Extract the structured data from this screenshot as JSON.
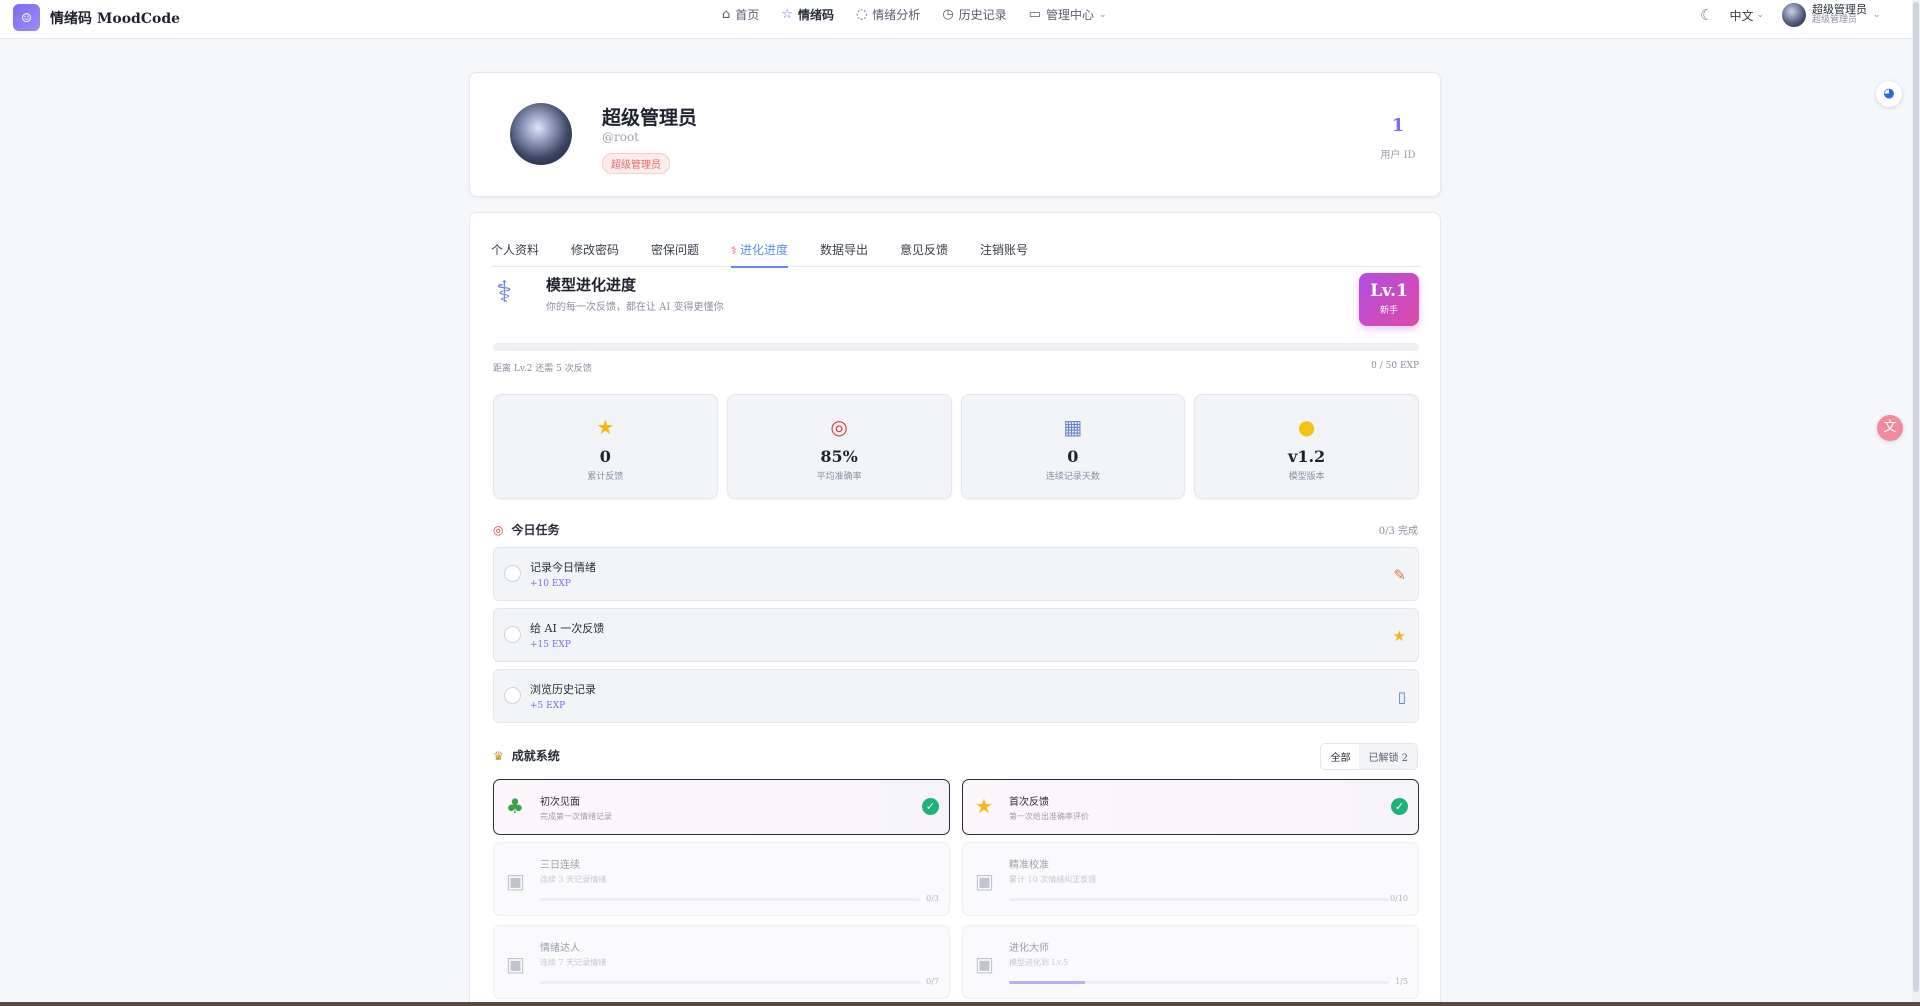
{
  "brand": {
    "logo_glyph": "☺",
    "name": "情绪码 MoodCode"
  },
  "nav": [
    {
      "icon": "home-icon",
      "glyph": "⌂",
      "label": "首页",
      "active": false
    },
    {
      "icon": "star-icon",
      "glyph": "☆",
      "label": "情绪码",
      "active": true
    },
    {
      "icon": "chat-icon",
      "glyph": "◌",
      "label": "情绪分析",
      "active": false
    },
    {
      "icon": "clock-icon",
      "glyph": "◷",
      "label": "历史记录",
      "active": false
    },
    {
      "icon": "admin-icon",
      "glyph": "▭",
      "label": "管理中心",
      "active": false
    }
  ],
  "topright": {
    "lang": "中文",
    "user_name": "超级管理员",
    "user_role": "超级管理员"
  },
  "profile": {
    "name": "超级管理员",
    "handle": "@root",
    "badge": "超级管理员",
    "id_value": "1",
    "id_label": "用户 ID"
  },
  "tabs": [
    "个人资料",
    "修改密码",
    "密保问题",
    "进化进度",
    "数据导出",
    "意见反馈",
    "注销账号"
  ],
  "evolution": {
    "title": "模型进化进度",
    "subtitle": "你的每一次反馈，都在让 AI 变得更懂你",
    "level": "Lv.1",
    "level_name": "新手",
    "progress_left": "距离 Lv.2 还需 5 次反馈",
    "progress_right": "0 / 50 EXP",
    "progress_fraction": 0.0
  },
  "stats": [
    {
      "icon": "star-icon",
      "glyph": "★",
      "color": "#f5b81c",
      "value": "0",
      "label": "累计反馈"
    },
    {
      "icon": "target-icon",
      "glyph": "◎",
      "color": "#e03b3b",
      "value": "85%",
      "label": "平均准确率"
    },
    {
      "icon": "chart-icon",
      "glyph": "▦",
      "color": "#6b86c8",
      "value": "0",
      "label": "连续记录天数"
    },
    {
      "icon": "bulb-icon",
      "glyph": "●",
      "color": "#f5c21c",
      "value": "v1.2",
      "label": "模型版本"
    }
  ],
  "tasks": {
    "title": "今日任务",
    "status": "0/3 完成",
    "items": [
      {
        "name": "记录今日情绪",
        "exp": "+10 EXP",
        "icon": "memo-icon",
        "glyph": "✎",
        "color": "#e07a3b"
      },
      {
        "name": "给 AI 一次反馈",
        "exp": "+15 EXP",
        "icon": "star-icon",
        "glyph": "★",
        "color": "#f5b81c"
      },
      {
        "name": "浏览历史记录",
        "exp": "+5 EXP",
        "icon": "book-icon",
        "glyph": "▯",
        "color": "#4a7fd0"
      }
    ]
  },
  "achievements": {
    "title": "成就系统",
    "filter_all": "全部",
    "filter_unlocked": "已解锁 2",
    "items": [
      {
        "name": "初次见面",
        "desc": "完成第一次情绪记录",
        "icon": "sprout-icon",
        "glyph": "♣",
        "color": "#3aa04a",
        "done": true
      },
      {
        "name": "首次反馈",
        "desc": "第一次给出准确率评价",
        "icon": "star-icon",
        "glyph": "★",
        "color": "#f5b81c",
        "done": true
      },
      {
        "name": "三日连续",
        "desc": "连续 3 天记录情绪",
        "icon": "lock-icon",
        "glyph": "▣",
        "done": false,
        "progress": 0,
        "count": "0/3"
      },
      {
        "name": "精准校准",
        "desc": "累计 10 次情绪纠正反馈",
        "icon": "lock-icon",
        "glyph": "▣",
        "done": false,
        "progress": 0,
        "count": "0/10"
      },
      {
        "name": "情绪达人",
        "desc": "连续 7 天记录情绪",
        "icon": "lock-icon",
        "glyph": "▣",
        "done": false,
        "progress": 0,
        "count": "0/7"
      },
      {
        "name": "进化大师",
        "desc": "模型进化到 Lv.5",
        "icon": "lock-icon",
        "glyph": "▣",
        "done": false,
        "progress": 0.2,
        "count": "1/5"
      }
    ]
  }
}
